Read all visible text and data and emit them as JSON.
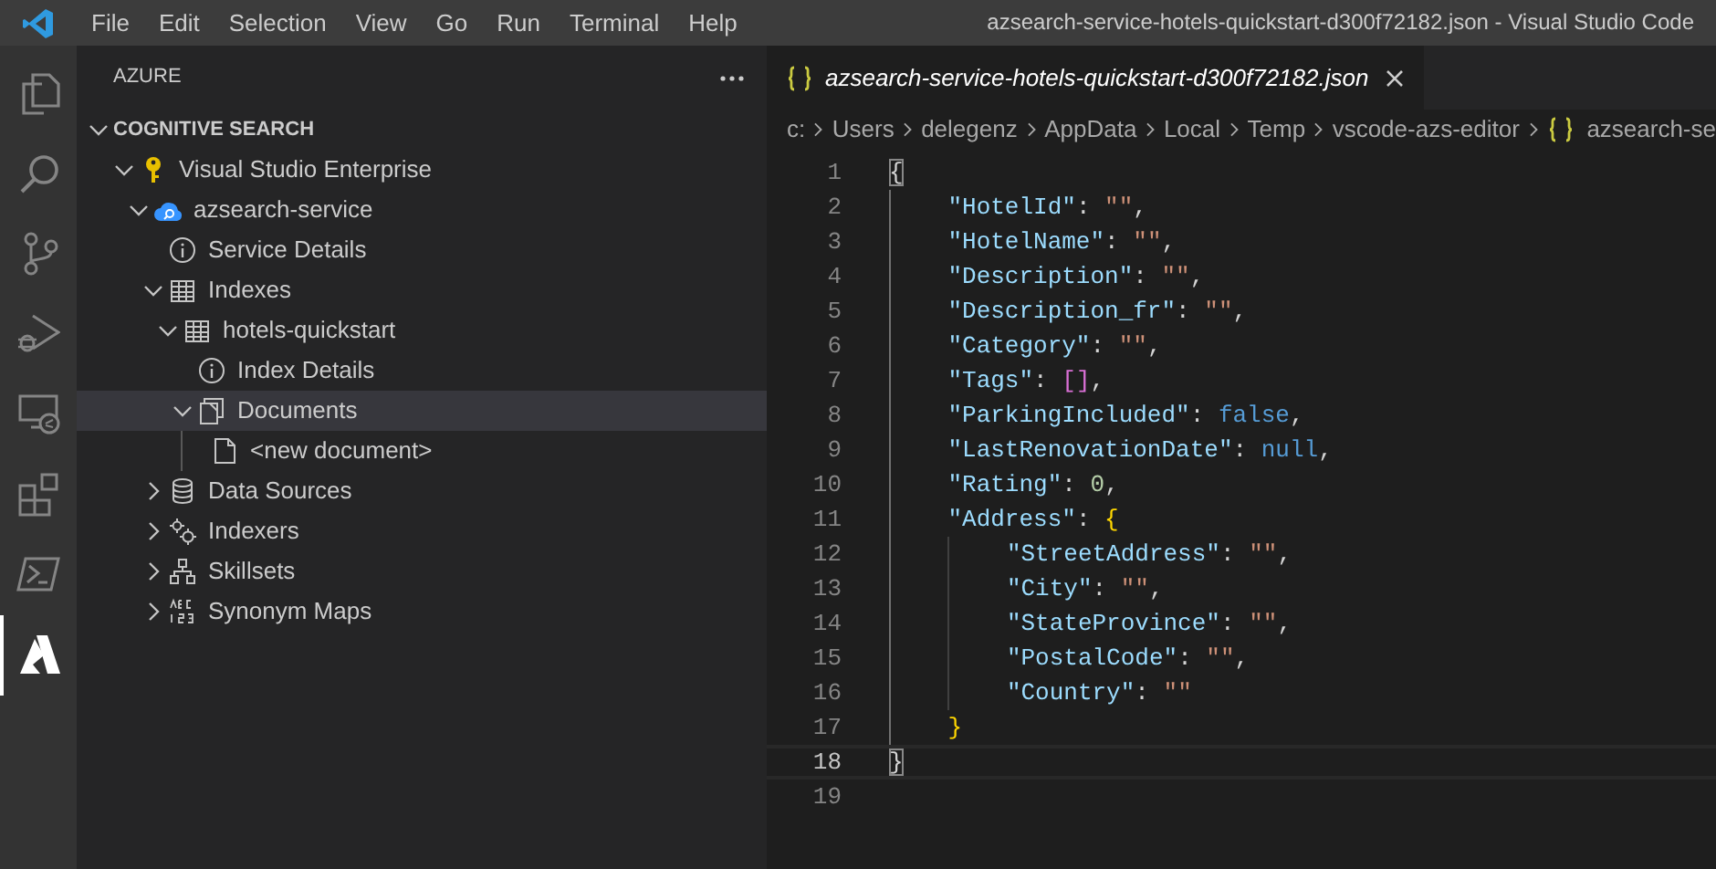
{
  "title_bar": {
    "menu": [
      "File",
      "Edit",
      "Selection",
      "View",
      "Go",
      "Run",
      "Terminal",
      "Help"
    ],
    "title": "azsearch-service-hotels-quickstart-d300f72182.json - Visual Studio Code"
  },
  "activity_bar": [
    {
      "kind": "explorer",
      "selected": false
    },
    {
      "kind": "search",
      "selected": false
    },
    {
      "kind": "source-control",
      "selected": false
    },
    {
      "kind": "debug",
      "selected": false
    },
    {
      "kind": "remote",
      "selected": false
    },
    {
      "kind": "extensions",
      "selected": false
    },
    {
      "kind": "terminal",
      "selected": false
    },
    {
      "kind": "azure",
      "selected": true
    }
  ],
  "sidebar": {
    "title": "AZURE",
    "section": {
      "label": "COGNITIVE SEARCH",
      "expanded": true,
      "tree": [
        {
          "label": "Visual Studio Enterprise",
          "kind": "key",
          "expanded": true,
          "selected": false,
          "children": [
            {
              "label": "azsearch-service",
              "kind": "cloud",
              "expanded": true,
              "selected": false,
              "children": [
                {
                  "label": "Service Details",
                  "kind": "info",
                  "selected": false
                },
                {
                  "label": "Indexes",
                  "kind": "table",
                  "expanded": true,
                  "selected": false,
                  "children": [
                    {
                      "label": "hotels-quickstart",
                      "kind": "table",
                      "expanded": true,
                      "selected": false,
                      "children": [
                        {
                          "label": "Index Details",
                          "kind": "info",
                          "selected": false
                        },
                        {
                          "label": "Documents",
                          "kind": "documents",
                          "expanded": true,
                          "selected": true,
                          "children": [
                            {
                              "label": "<new document>",
                              "kind": "file",
                              "selected": false
                            }
                          ]
                        }
                      ]
                    }
                  ]
                },
                {
                  "label": "Data Sources",
                  "kind": "database",
                  "expanded": false,
                  "selected": false
                },
                {
                  "label": "Indexers",
                  "kind": "gears",
                  "expanded": false,
                  "selected": false
                },
                {
                  "label": "Skillsets",
                  "kind": "hierarchy",
                  "expanded": false,
                  "selected": false
                },
                {
                  "label": "Synonym Maps",
                  "kind": "abc",
                  "expanded": false,
                  "selected": false
                }
              ]
            }
          ]
        }
      ]
    }
  },
  "editor": {
    "tabs": [
      {
        "label": "azsearch-service-hotels-quickstart-d300f72182.json",
        "selected": true,
        "preview": true
      }
    ],
    "breadcrumb": [
      {
        "label": "c:",
        "kind": "folder"
      },
      {
        "label": "Users",
        "kind": "folder"
      },
      {
        "label": "delegenz",
        "kind": "folder"
      },
      {
        "label": "AppData",
        "kind": "folder"
      },
      {
        "label": "Local",
        "kind": "folder"
      },
      {
        "label": "Temp",
        "kind": "folder"
      },
      {
        "label": "vscode-azs-editor",
        "kind": "folder"
      },
      {
        "label": "azsearch-se",
        "kind": "json"
      }
    ],
    "lines": [
      {
        "number": "1",
        "current": false,
        "tokens": [
          {
            "text": "{",
            "kind": "punct",
            "matched": true
          }
        ]
      },
      {
        "number": "2",
        "current": false,
        "tokens": [
          {
            "text": "    \"HotelId\"",
            "kind": "key"
          },
          {
            "text": ": ",
            "kind": "punct"
          },
          {
            "text": "\"\"",
            "kind": "string"
          },
          {
            "text": ",",
            "kind": "punct"
          }
        ]
      },
      {
        "number": "3",
        "current": false,
        "tokens": [
          {
            "text": "    \"HotelName\"",
            "kind": "key"
          },
          {
            "text": ": ",
            "kind": "punct"
          },
          {
            "text": "\"\"",
            "kind": "string"
          },
          {
            "text": ",",
            "kind": "punct"
          }
        ]
      },
      {
        "number": "4",
        "current": false,
        "tokens": [
          {
            "text": "    \"Description\"",
            "kind": "key"
          },
          {
            "text": ": ",
            "kind": "punct"
          },
          {
            "text": "\"\"",
            "kind": "string"
          },
          {
            "text": ",",
            "kind": "punct"
          }
        ]
      },
      {
        "number": "5",
        "current": false,
        "tokens": [
          {
            "text": "    \"Description_fr\"",
            "kind": "key"
          },
          {
            "text": ": ",
            "kind": "punct"
          },
          {
            "text": "\"\"",
            "kind": "string"
          },
          {
            "text": ",",
            "kind": "punct"
          }
        ]
      },
      {
        "number": "6",
        "current": false,
        "tokens": [
          {
            "text": "    \"Category\"",
            "kind": "key"
          },
          {
            "text": ": ",
            "kind": "punct"
          },
          {
            "text": "\"\"",
            "kind": "string"
          },
          {
            "text": ",",
            "kind": "punct"
          }
        ]
      },
      {
        "number": "7",
        "current": false,
        "tokens": [
          {
            "text": "    \"Tags\"",
            "kind": "key"
          },
          {
            "text": ": ",
            "kind": "punct"
          },
          {
            "text": "[]",
            "kind": "bracket2"
          },
          {
            "text": ",",
            "kind": "punct"
          }
        ]
      },
      {
        "number": "8",
        "current": false,
        "tokens": [
          {
            "text": "    \"ParkingIncluded\"",
            "kind": "key"
          },
          {
            "text": ": ",
            "kind": "punct"
          },
          {
            "text": "false",
            "kind": "keyword"
          },
          {
            "text": ",",
            "kind": "punct"
          }
        ]
      },
      {
        "number": "9",
        "current": false,
        "tokens": [
          {
            "text": "    \"LastRenovationDate\"",
            "kind": "key"
          },
          {
            "text": ": ",
            "kind": "punct"
          },
          {
            "text": "null",
            "kind": "keyword"
          },
          {
            "text": ",",
            "kind": "punct"
          }
        ]
      },
      {
        "number": "10",
        "current": false,
        "tokens": [
          {
            "text": "    \"Rating\"",
            "kind": "key"
          },
          {
            "text": ": ",
            "kind": "punct"
          },
          {
            "text": "0",
            "kind": "number"
          },
          {
            "text": ",",
            "kind": "punct"
          }
        ]
      },
      {
        "number": "11",
        "current": false,
        "tokens": [
          {
            "text": "    \"Address\"",
            "kind": "key"
          },
          {
            "text": ": ",
            "kind": "punct"
          },
          {
            "text": "{",
            "kind": "bracket1"
          }
        ]
      },
      {
        "number": "12",
        "current": false,
        "tokens": [
          {
            "text": "        \"StreetAddress\"",
            "kind": "key"
          },
          {
            "text": ": ",
            "kind": "punct"
          },
          {
            "text": "\"\"",
            "kind": "string"
          },
          {
            "text": ",",
            "kind": "punct"
          }
        ]
      },
      {
        "number": "13",
        "current": false,
        "tokens": [
          {
            "text": "        \"City\"",
            "kind": "key"
          },
          {
            "text": ": ",
            "kind": "punct"
          },
          {
            "text": "\"\"",
            "kind": "string"
          },
          {
            "text": ",",
            "kind": "punct"
          }
        ]
      },
      {
        "number": "14",
        "current": false,
        "tokens": [
          {
            "text": "        \"StateProvince\"",
            "kind": "key"
          },
          {
            "text": ": ",
            "kind": "punct"
          },
          {
            "text": "\"\"",
            "kind": "string"
          },
          {
            "text": ",",
            "kind": "punct"
          }
        ]
      },
      {
        "number": "15",
        "current": false,
        "tokens": [
          {
            "text": "        \"PostalCode\"",
            "kind": "key"
          },
          {
            "text": ": ",
            "kind": "punct"
          },
          {
            "text": "\"\"",
            "kind": "string"
          },
          {
            "text": ",",
            "kind": "punct"
          }
        ]
      },
      {
        "number": "16",
        "current": false,
        "tokens": [
          {
            "text": "        \"Country\"",
            "kind": "key"
          },
          {
            "text": ": ",
            "kind": "punct"
          },
          {
            "text": "\"\"",
            "kind": "string"
          }
        ]
      },
      {
        "number": "17",
        "current": false,
        "tokens": [
          {
            "text": "    }",
            "kind": "bracket1"
          }
        ]
      },
      {
        "number": "18",
        "current": true,
        "tokens": [
          {
            "text": "}",
            "kind": "punct",
            "matched": true
          }
        ]
      },
      {
        "number": "19",
        "current": false
      }
    ]
  }
}
